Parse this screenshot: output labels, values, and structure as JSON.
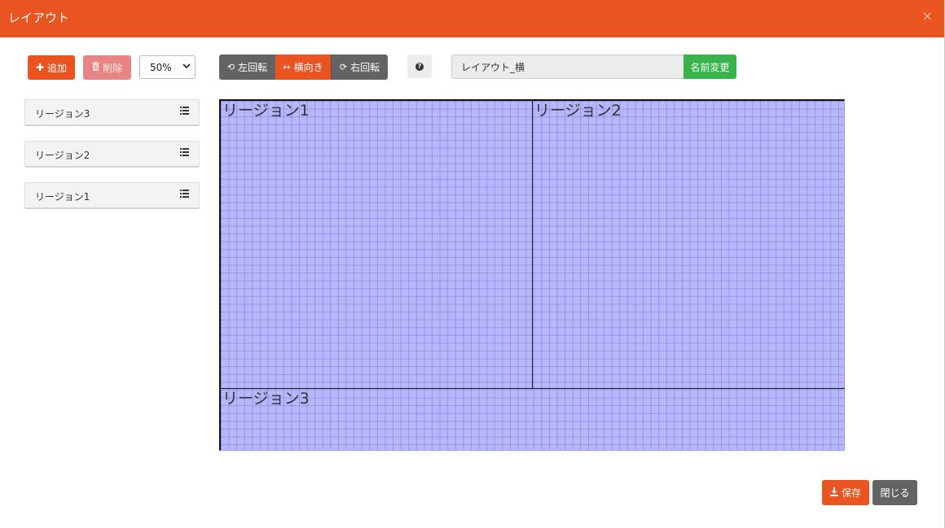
{
  "header": {
    "title": "レイアウト",
    "close_glyph": "×"
  },
  "toolbar": {
    "add_label": "追加",
    "add_icon": "plus-icon",
    "delete_label": "削除",
    "delete_icon": "trash-icon",
    "zoom_value": "50%",
    "rotate_left_label": "左回転",
    "landscape_label": "横向き",
    "rotate_right_label": "右回転",
    "help_icon": "question-circle-icon",
    "layout_name_value": "レイアウト_横",
    "rename_label": "名前変更"
  },
  "regions_list": [
    {
      "label": "リージョン3",
      "icon": "list-icon"
    },
    {
      "label": "リージョン2",
      "icon": "list-icon"
    },
    {
      "label": "リージョン1",
      "icon": "list-icon"
    }
  ],
  "canvas": {
    "regions": [
      {
        "label": "リージョン1"
      },
      {
        "label": "リージョン2"
      },
      {
        "label": "リージョン3"
      }
    ]
  },
  "footer": {
    "save_label": "保存",
    "save_icon": "download-icon",
    "close_label": "閉じる"
  },
  "colors": {
    "accent": "#e95420",
    "success": "#38b44a",
    "dark": "#636363",
    "canvas_fill": "#b7b7fb"
  }
}
